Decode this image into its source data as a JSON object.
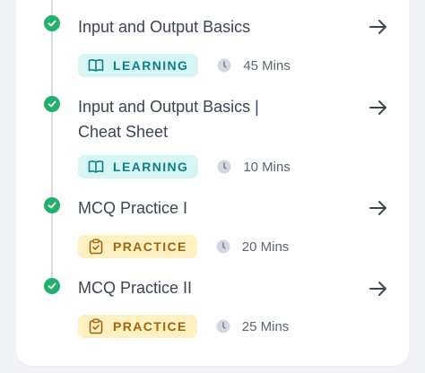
{
  "colors": {
    "check": "#22b06a",
    "learning_bg": "#d6f5f5",
    "learning_fg": "#0d7e86",
    "practice_bg": "#fff1c2",
    "practice_fg": "#a5620a",
    "text": "#3a4556"
  },
  "items": [
    {
      "title": "Input and Output Basics",
      "badge": "LEARNING",
      "badge_icon": "book-icon",
      "duration": "45 Mins",
      "status_icon": "check-circle-icon"
    },
    {
      "title": "Input and Output Basics | Cheat Sheet",
      "badge": "LEARNING",
      "badge_icon": "book-icon",
      "duration": "10 Mins",
      "status_icon": "check-circle-icon"
    },
    {
      "title": "MCQ Practice I",
      "badge": "PRACTICE",
      "badge_icon": "clipboard-check-icon",
      "duration": "20 Mins",
      "status_icon": "check-circle-icon"
    },
    {
      "title": "MCQ Practice II",
      "badge": "PRACTICE",
      "badge_icon": "clipboard-check-icon",
      "duration": "25 Mins",
      "status_icon": "check-circle-icon"
    }
  ]
}
